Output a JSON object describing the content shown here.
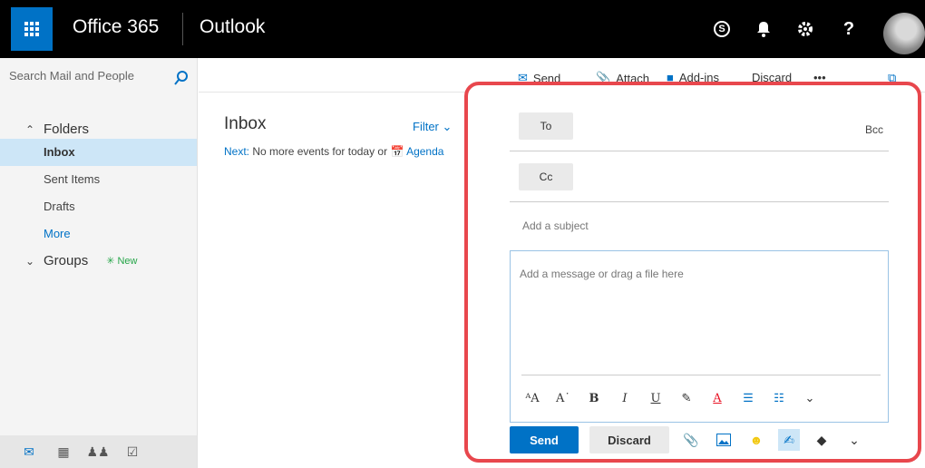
{
  "header": {
    "brand": "Office 365",
    "app": "Outlook",
    "icons": [
      "skype-icon",
      "bell-icon",
      "gear-icon",
      "help-icon"
    ],
    "help_label": "?",
    "skype_label": "S"
  },
  "leftpane": {
    "search_placeholder": "Search Mail and People",
    "folders_label": "Folders",
    "folders": [
      "Inbox",
      "Sent Items",
      "Drafts"
    ],
    "more_label": "More",
    "groups_label": "Groups",
    "groups_badge": "New"
  },
  "toolbar": {
    "send": "Send",
    "attach": "Attach",
    "addins": "Add-ins",
    "discard": "Discard",
    "more": "•••"
  },
  "msglist": {
    "title": "Inbox",
    "filter": "Filter",
    "next_label": "Next:",
    "next_text": "No more events for today or",
    "agenda": "Agenda"
  },
  "compose": {
    "to": "To",
    "bcc": "Bcc",
    "cc": "Cc",
    "subject_placeholder": "Add a subject",
    "body_placeholder": "Add a message or drag a file here",
    "send": "Send",
    "discard": "Discard",
    "accent": "#0072c6",
    "highlight_border": "#e8474d"
  }
}
